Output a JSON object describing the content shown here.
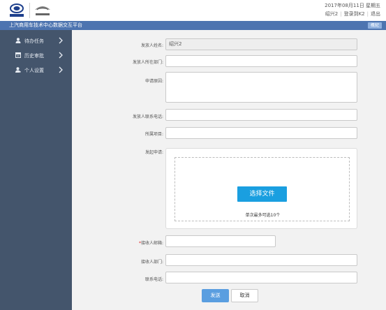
{
  "header": {
    "date": "2017年08月11日 星期五",
    "user": "绍兴2",
    "login_as": "登录到K2",
    "logout": "退出",
    "logo1_alt": "上汽集团",
    "logo2_alt": "上汽大通"
  },
  "titlebar": {
    "title": "上汽商用车技术中心数据交互平台",
    "tag": "概紀"
  },
  "sidebar": {
    "items": [
      {
        "label": "待办任务",
        "icon": "user-icon"
      },
      {
        "label": "历史审批",
        "icon": "document-icon"
      },
      {
        "label": "个人设置",
        "icon": "user-settings-icon"
      }
    ]
  },
  "form": {
    "sender_name_label": "发放人姓名:",
    "sender_name_value": "绍兴2",
    "sender_dept_label": "发放人所在部门:",
    "reason_label": "申请原因:",
    "sender_phone_label": "发放人联系电话:",
    "project_label": "所属项目:",
    "apply_label": "发起申请:",
    "choose_file": "选择文件",
    "upload_hint": "单次最多可选10个",
    "receiver_email_label": "接收人邮箱:",
    "receiver_email_required": "*",
    "receiver_dept_label": "接收人部门:",
    "contact_phone_label": "联系电话:",
    "send_button": "发送",
    "cancel_button": "取消"
  },
  "colors": {
    "titlebar": "#4d74b0",
    "sidebar": "#44556c",
    "primary_button": "#1a9fe0",
    "send_button": "#5a9ee0"
  }
}
